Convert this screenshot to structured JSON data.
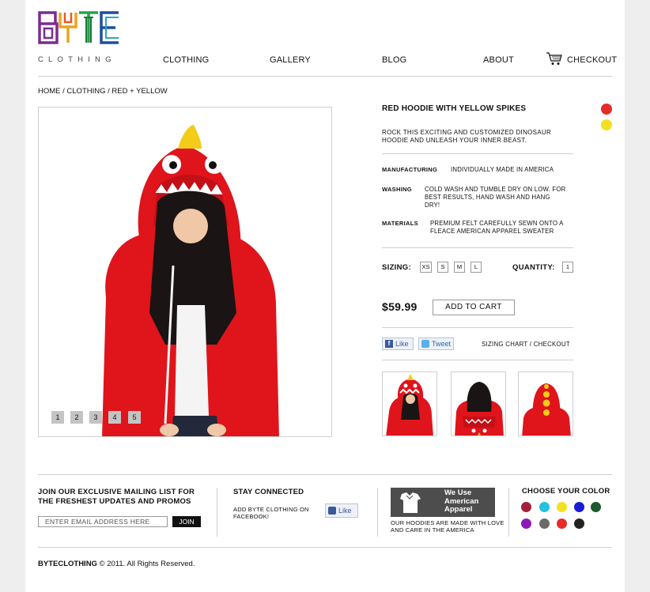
{
  "brand": {
    "logo_text": "BYTE",
    "sub": "CLOTHING"
  },
  "nav": {
    "clothing": "CLOTHING",
    "gallery": "GALLERY",
    "blog": "BLOG",
    "about": "ABOUT",
    "checkout": "CHECKOUT"
  },
  "breadcrumb": "HOME / CLOTHING / RED + YELLOW",
  "gallery": {
    "pages": [
      "1",
      "2",
      "3",
      "4",
      "5"
    ]
  },
  "product": {
    "title": "RED HOODIE WITH YELLOW SPIKES",
    "description": "ROCK THIS EXCITING AND CUSTOMIZED DINOSAUR HOODIE AND UNLEASH YOUR INNER BEAST.",
    "color_options": [
      "#e62b2b",
      "#f3e01f"
    ],
    "specs": {
      "manufacturing_label": "MANUFACTURING",
      "manufacturing_value": "INDIVIDUALLY MADE IN AMERICA",
      "washing_label": "WASHING",
      "washing_value": "COLD WASH AND TUMBLE DRY ON LOW. FOR BEST RESULTS, HAND WASH AND HANG DRY!",
      "materials_label": "MATERIALS",
      "materials_value": "PREMIUM FELT CAREFULLY SEWN ONTO A FLEACE AMERICAN APPAREL SWEATER"
    },
    "sizing_label": "SIZING:",
    "sizes": [
      "XS",
      "S",
      "M",
      "L"
    ],
    "quantity_label": "QUANTITY:",
    "quantity_value": "1",
    "price": "$59.99",
    "add_to_cart": "ADD TO CART",
    "like": "Like",
    "tweet": "Tweet",
    "sizing_chart": "SIZING CHART / CHECKOUT"
  },
  "footer": {
    "mailing_title": "JOIN OUR EXCLUSIVE MAILING LIST FOR THE FRESHEST UPDATES AND PROMOS",
    "email_placeholder": "ENTER EMAIL ADDRESS HERE",
    "join": "JOIN",
    "stay_title": "STAY CONNECTED",
    "stay_text": "ADD BYTE CLOTHING ON FACEBOOK!",
    "fb_like": "Like",
    "aa_text": "We Use American Apparel",
    "aa_caption": "OUR HOODIES ARE MADE WITH LOVE AND CARE IN THE AMERICA",
    "color_title": "CHOOSE YOUR COLOR",
    "colors": [
      "#a31f3a",
      "#1fc3e0",
      "#f3e01f",
      "#1b1bd6",
      "#1d5a2a",
      "#8e1bb8",
      "#6a6a6a",
      "#e62b2b",
      "#222222"
    ],
    "copyright_brand": "BYTECLOTHING",
    "copyright_rest": " © 2011.  All Rights Reserved."
  },
  "accent": {
    "cart_button_border": "#999999",
    "join_bg": "#111111"
  }
}
